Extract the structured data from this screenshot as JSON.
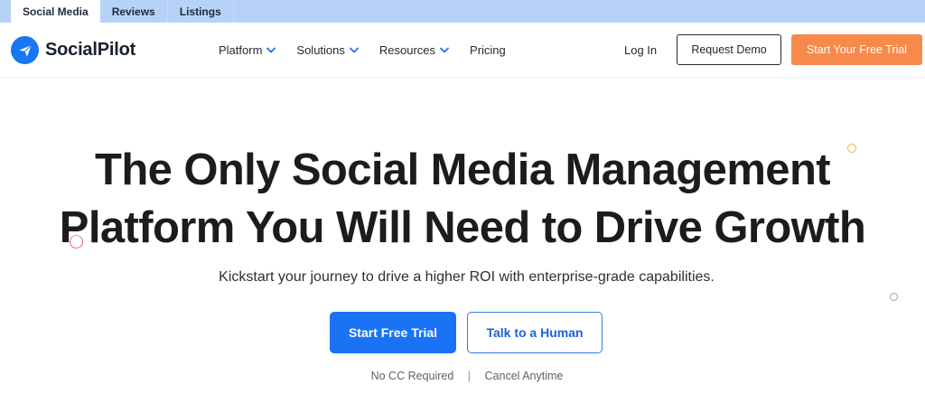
{
  "tabs": [
    {
      "label": "Social Media",
      "active": true
    },
    {
      "label": "Reviews",
      "active": false
    },
    {
      "label": "Listings",
      "active": false
    }
  ],
  "brand": {
    "name": "SocialPilot",
    "logo_icon": "paper-plane-icon",
    "logo_color": "#1776f2"
  },
  "nav": {
    "items": [
      {
        "label": "Platform",
        "has_dropdown": true
      },
      {
        "label": "Solutions",
        "has_dropdown": true
      },
      {
        "label": "Resources",
        "has_dropdown": true
      },
      {
        "label": "Pricing",
        "has_dropdown": false
      }
    ],
    "login_label": "Log In",
    "demo_label": "Request Demo",
    "trial_label": "Start Your Free Trial"
  },
  "hero": {
    "headline_line1": "The Only Social Media Management",
    "headline_line2": "Platform You Will Need to Drive Growth",
    "subtitle": "Kickstart your journey to drive a higher ROI with enterprise-grade capabilities.",
    "primary_cta": "Start Free Trial",
    "secondary_cta": "Talk to a Human",
    "note_left": "No CC Required",
    "note_separator": "|",
    "note_right": "Cancel Anytime"
  },
  "colors": {
    "accent_blue": "#1a73f4",
    "accent_orange": "#f7894a",
    "tabbar_bg": "#b7d2f7"
  }
}
